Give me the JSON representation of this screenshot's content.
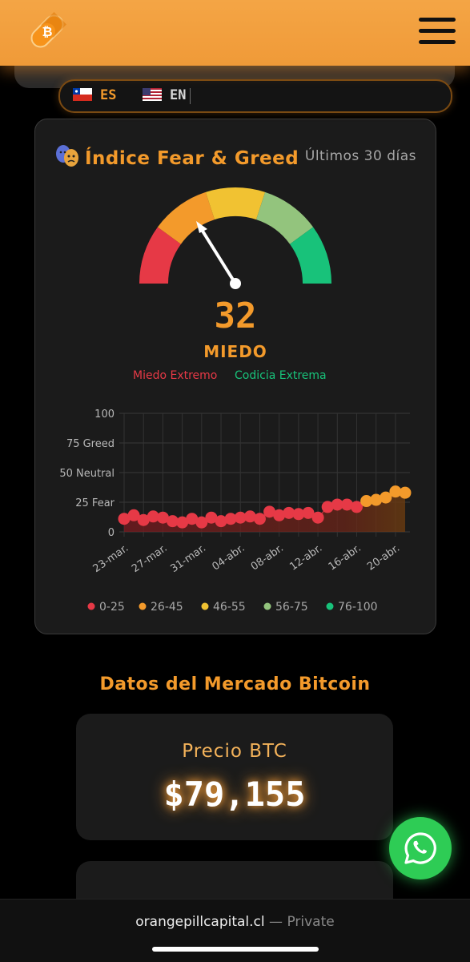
{
  "header": {
    "logo_icon": "bitcoin-pill-icon",
    "menu_icon": "hamburger-menu-icon"
  },
  "language": {
    "es": {
      "flag": "chile-flag-icon",
      "label": "ES"
    },
    "en": {
      "flag": "usa-flag-icon",
      "label": "EN"
    }
  },
  "fear_greed": {
    "icon": "theater-masks-icon",
    "title": "Índice Fear & Greed",
    "subtitle": "Últimos 30 días",
    "value": "32",
    "value_label": "MIEDO",
    "extreme_fear": "Miedo Extremo",
    "extreme_greed": "Codicia Extrema",
    "colors": {
      "extreme_fear": "#e63946",
      "fear": "#f39a2b",
      "neutral": "#f1c232",
      "greed": "#93c47d",
      "extreme_greed": "#18c27a"
    }
  },
  "chart_data": {
    "type": "line",
    "x": [
      "23-mar.",
      "24-mar.",
      "25-mar.",
      "26-mar.",
      "27-mar.",
      "28-mar.",
      "29-mar.",
      "30-mar.",
      "31-mar.",
      "01-abr.",
      "02-abr.",
      "03-abr.",
      "04-abr.",
      "05-abr.",
      "06-abr.",
      "07-abr.",
      "08-abr.",
      "09-abr.",
      "10-abr.",
      "11-abr.",
      "12-abr.",
      "13-abr.",
      "14-abr.",
      "15-abr.",
      "16-abr.",
      "17-abr.",
      "18-abr.",
      "19-abr.",
      "20-abr.",
      "21-abr."
    ],
    "values": [
      11,
      14,
      10,
      13,
      12,
      9,
      8,
      11,
      8,
      12,
      9,
      11,
      12,
      13,
      11,
      17,
      14,
      16,
      15,
      16,
      12,
      21,
      23,
      23,
      21,
      26,
      27,
      29,
      34,
      33
    ],
    "tick_labels": [
      "23-mar.",
      "27-mar.",
      "31-mar.",
      "04-abr.",
      "08-abr.",
      "12-abr.",
      "16-abr.",
      "20-abr."
    ],
    "y_ticks": [
      {
        "value": 100,
        "label": "100"
      },
      {
        "value": 75,
        "label": "75 Greed"
      },
      {
        "value": 50,
        "label": "50 Neutral"
      },
      {
        "value": 25,
        "label": "25 Fear"
      },
      {
        "value": 0,
        "label": "0"
      }
    ],
    "ylim": [
      0,
      100
    ],
    "grid": true,
    "legend_position": "bottom",
    "legend": [
      {
        "label": "0-25",
        "color": "#e63946"
      },
      {
        "label": "26-45",
        "color": "#f39a2b"
      },
      {
        "label": "46-55",
        "color": "#f1c232"
      },
      {
        "label": "56-75",
        "color": "#93c47d"
      },
      {
        "label": "76-100",
        "color": "#18c27a"
      }
    ]
  },
  "market": {
    "title": "Datos del Mercado Bitcoin",
    "price_label": "Precio BTC",
    "price_value": "$79,155"
  },
  "whatsapp_icon": "whatsapp-icon",
  "browser": {
    "domain": "orangepillcapital.cl",
    "suffix": "— Private"
  }
}
